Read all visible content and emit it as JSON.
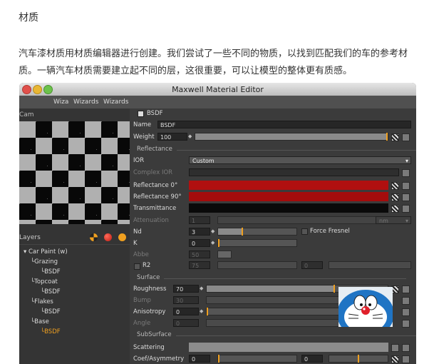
{
  "article": {
    "heading": "材质",
    "paragraph": "汽车漆材质用材质编辑器进行创建。我们尝试了一些不同的物质，以找到匹配我们的车的参考材质。一辆汽车材质需要建立起不同的层，这很重要，可以让模型的整体更有质感。"
  },
  "window": {
    "title": "Maxwell Material Editor",
    "menu": [
      "Wiza",
      "Wizards",
      "Wizards"
    ]
  },
  "left_panel": {
    "camera_label": "Cam",
    "layers_label": "Layers",
    "tree": [
      {
        "label": "Car Paint (w)",
        "level": 0
      },
      {
        "label": "Grazing",
        "level": 1
      },
      {
        "label": "BSDF",
        "level": 2
      },
      {
        "label": "Topcoat",
        "level": 1
      },
      {
        "label": "BSDF",
        "level": 2
      },
      {
        "label": "Flakes",
        "level": 1
      },
      {
        "label": "BSDF",
        "level": 2
      },
      {
        "label": "Base",
        "level": 1
      },
      {
        "label": "BSDF",
        "level": 2,
        "selected": true
      }
    ],
    "selected_color": "#f0a020"
  },
  "editor": {
    "bsdf_header": "BSDF",
    "name_label": "Name",
    "name_value": "BSDF",
    "weight_label": "Weight",
    "weight_value": "100",
    "reflectance_section": "Reflectance",
    "ior_label": "IOR",
    "ior_value": "Custom",
    "complex_ior_label": "Complex IOR",
    "reflectance0_label": "Reflectance 0°",
    "reflectance90_label": "Reflectance 90°",
    "transmittance_label": "Transmittance",
    "attenuation_label": "Attenuation",
    "attenuation_value": "1",
    "attenuation_unit": "nm",
    "nd_label": "Nd",
    "nd_value": "3",
    "force_fresnel_label": "Force Fresnel",
    "k_label": "K",
    "k_value": "0",
    "abbe_label": "Abbe",
    "abbe_value": "50",
    "r2_label": "R2",
    "r2_value": "75",
    "r2_value2": "0",
    "surface_section": "Surface",
    "roughness_label": "Roughness",
    "roughness_value": "70",
    "bump_label": "Bump",
    "bump_value": "30",
    "anisotropy_label": "Anisotropy",
    "anisotropy_value": "0",
    "angle_label": "Angle",
    "angle_value": "0",
    "subsurface_section": "SubSurface",
    "scattering_label": "Scattering",
    "coef_label": "Coef/Asymmetry",
    "coef_value": "0",
    "coef_value2": "0",
    "reflectance0_color": "#b01010",
    "reflectance90_color": "#a40c0c",
    "transmittance_color": "#0a0a0a",
    "accent_color": "#f0a020"
  }
}
